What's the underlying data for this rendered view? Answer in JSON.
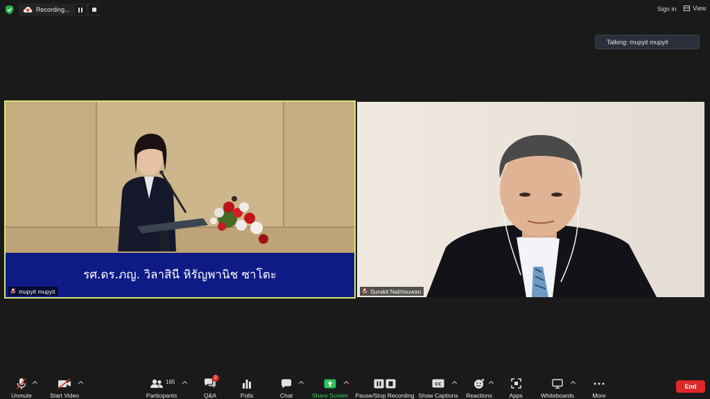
{
  "topbar": {
    "recording_text": "Recording...",
    "sign_in": "Sign in",
    "view": "View"
  },
  "talking_indicator": "Talking: mupyit mupyit",
  "videos": [
    {
      "name": "mupyit mupyit",
      "caption": "รศ.ดร.ภญ. วิลาสินี หิรัญพานิช ซาโตะ",
      "highlight_color": "#d9e876"
    },
    {
      "name": "Surakit Nathisuwan"
    }
  ],
  "toolbar": {
    "unmute": "Unmute",
    "start_video": "Start Video",
    "participants": "Participants",
    "participants_count": "165",
    "qa": "Q&A",
    "qa_badge": "2",
    "polls": "Polls",
    "chat": "Chat",
    "share_screen": "Share Screen",
    "pause_stop_recording": "Pause/Stop Recording",
    "show_captions": "Show Captions",
    "reactions": "Reactions",
    "apps": "Apps",
    "whiteboards": "Whiteboards",
    "more": "More",
    "end": "End"
  },
  "colors": {
    "background": "#1a1a1a",
    "share_green": "#35d25d",
    "end_red": "#e02828",
    "caption_blue": "#0e1a85"
  }
}
